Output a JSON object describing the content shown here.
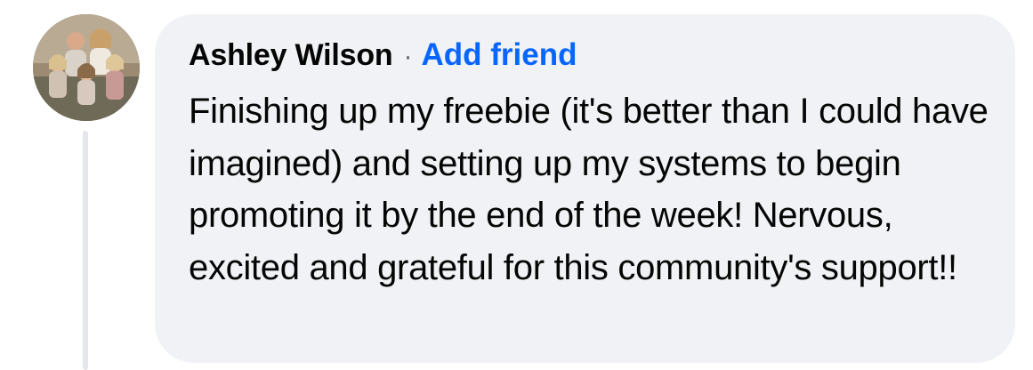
{
  "comment": {
    "author": "Ashley Wilson",
    "separator": "·",
    "action_label": "Add friend",
    "text": "Finishing up my freebie (it's better than I could have imagined) and setting up my systems to begin promoting it by the end of the week! Nervous, excited and grateful for this community's support!!"
  },
  "colors": {
    "bubble": "#f0f2f5",
    "link": "#0866ff",
    "text": "#050505",
    "thread_line": "#e4e6eb"
  },
  "icons": {
    "avatar": "profile-photo"
  }
}
